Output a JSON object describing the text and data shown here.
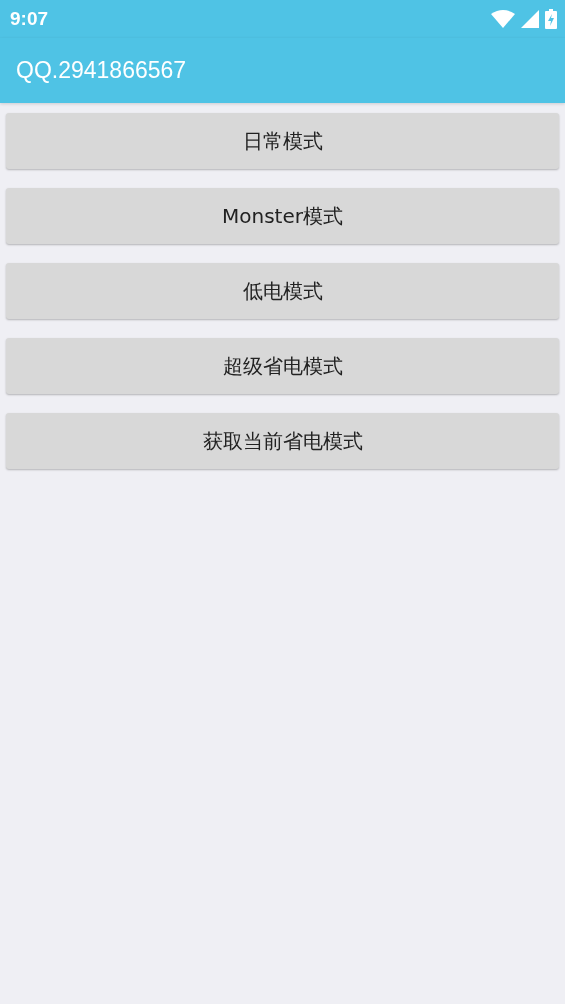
{
  "status_bar": {
    "time": "9:07",
    "charging": true
  },
  "app_bar": {
    "title": "QQ.2941866567"
  },
  "buttons": [
    {
      "label": "日常模式"
    },
    {
      "label": "Monster模式"
    },
    {
      "label": "低电模式"
    },
    {
      "label": "超级省电模式"
    },
    {
      "label": "获取当前省电模式"
    }
  ]
}
